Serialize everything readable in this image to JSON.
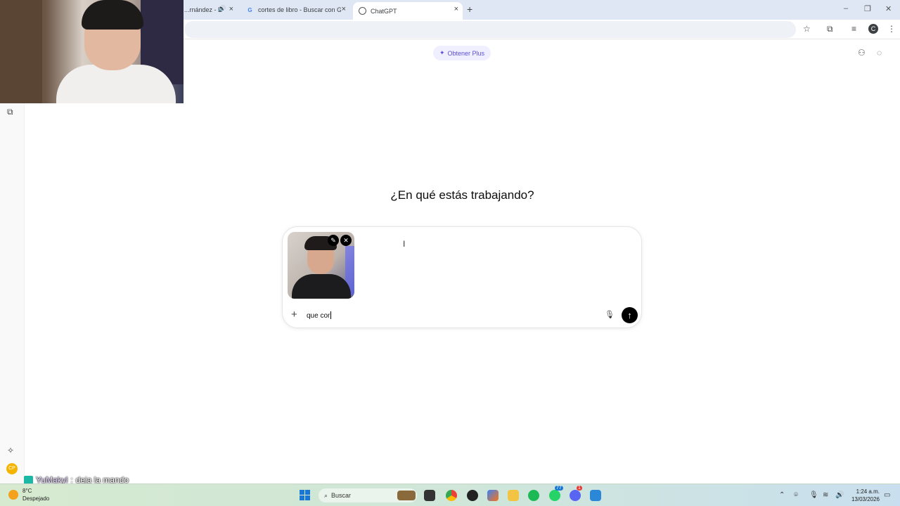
{
  "browser": {
    "tabs": [
      {
        "title": "...rnández - E",
        "favicon": "speaker-icon",
        "active": false
      },
      {
        "title": "cortes de libro - Buscar con Goo",
        "favicon": "google-icon",
        "active": false
      },
      {
        "title": "ChatGPT",
        "favicon": "chatgpt-icon",
        "active": true
      }
    ]
  },
  "page": {
    "upgrade_label": "Obtener Plus",
    "headline": "¿En qué estás trabajando?",
    "composer": {
      "typed_text": "que cor",
      "attachment": "photo-thumbnail"
    }
  },
  "stream_chat": {
    "user": "YuMakyl",
    "separator": ":",
    "message": "deja la mando"
  },
  "taskbar": {
    "weather_temp": "8°C",
    "weather_desc": "Despejado",
    "search_label": "Buscar",
    "time": "1:24 a.m.",
    "date": "13/03/2026",
    "badge_whatsapp": "77",
    "badge_discord": "1"
  },
  "colors": {
    "accent": "#5b4fd6",
    "send_button": "#000000",
    "taskbar_start": "#d6ead0"
  }
}
